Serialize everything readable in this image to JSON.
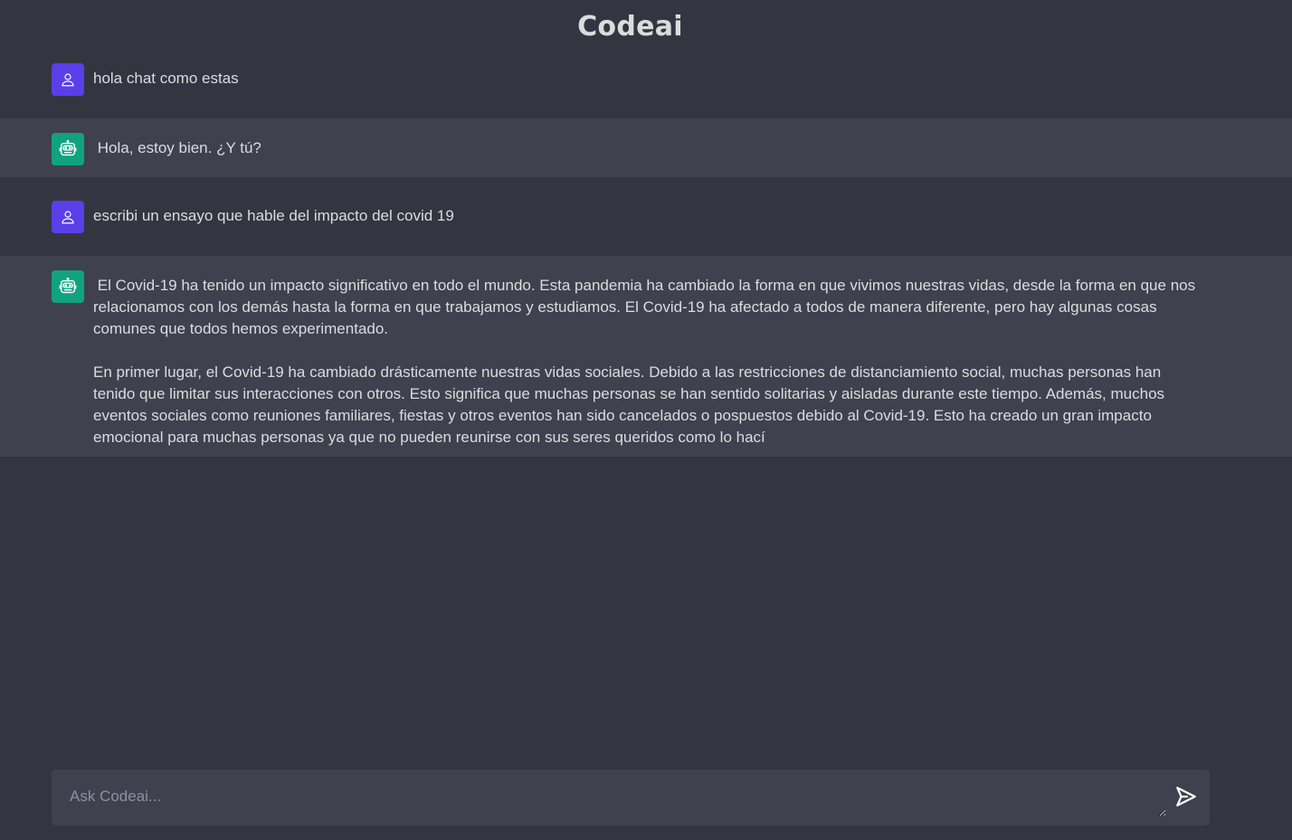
{
  "app": {
    "title": "Codeai"
  },
  "messages": [
    {
      "role": "user",
      "icon": "user-icon",
      "text": "hola chat como estas"
    },
    {
      "role": "bot",
      "icon": "robot-icon",
      "text": " Hola, estoy bien. ¿Y tú?"
    },
    {
      "role": "user",
      "icon": "user-icon",
      "text": "escribi un ensayo que hable del impacto del covid 19"
    },
    {
      "role": "bot",
      "icon": "robot-icon",
      "text": " El Covid-19 ha tenido un impacto significativo en todo el mundo. Esta pandemia ha cambiado la forma en que vivimos nuestras vidas, desde la forma en que nos relacionamos con los demás hasta la forma en que trabajamos y estudiamos. El Covid-19 ha afectado a todos de manera diferente, pero hay algunas cosas comunes que todos hemos experimentado.\n\nEn primer lugar, el Covid-19 ha cambiado drásticamente nuestras vidas sociales. Debido a las restricciones de distanciamiento social, muchas personas han tenido que limitar sus interacciones con otros. Esto significa que muchas personas se han sentido solitarias y aisladas durante este tiempo. Además, muchos eventos sociales como reuniones familiares, fiestas y otros eventos han sido cancelados o pospuestos debido al Covid-19. Esto ha creado un gran impacto emocional para muchas personas ya que no pueden reunirse con sus seres queridos como lo hací"
    }
  ],
  "composer": {
    "placeholder": "Ask Codeai...",
    "value": "",
    "send_icon": "send-icon"
  },
  "colors": {
    "background": "#343541",
    "bot_row": "#40414f",
    "user_avatar": "#5a3ee8",
    "bot_avatar": "#10a37f",
    "text": "#dcdcdc"
  }
}
